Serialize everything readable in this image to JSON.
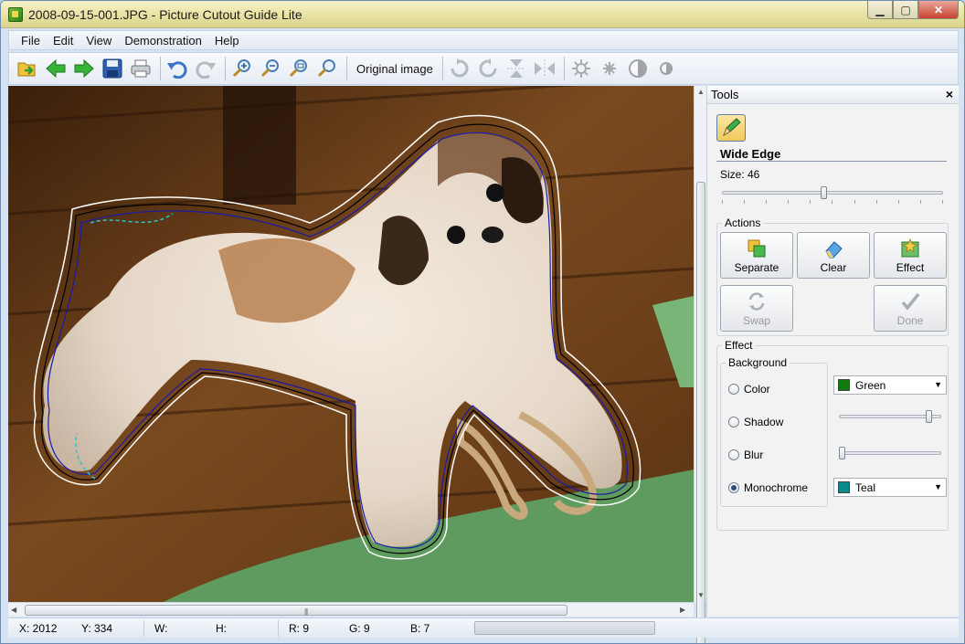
{
  "window": {
    "title": "2008-09-15-001.JPG - Picture Cutout Guide Lite"
  },
  "menu": [
    "File",
    "Edit",
    "View",
    "Demonstration",
    "Help"
  ],
  "toolbar": {
    "view_label": "Original image",
    "icons": [
      "open-icon",
      "back-icon",
      "forward-icon",
      "save-icon",
      "print-icon",
      "undo-icon",
      "redo-icon",
      "zoom-in-icon",
      "zoom-out-icon",
      "zoom-fit-icon",
      "zoom-actual-icon",
      "rotate-right-icon",
      "rotate-left-icon",
      "flip-vertical-icon",
      "flip-horizontal-icon",
      "brightness-icon",
      "settings-icon",
      "contrast-icon",
      "saturation-icon"
    ]
  },
  "colors": {
    "edge_outer": "#ffffff",
    "edge_mid": "#000000",
    "edge_inner": "#1a1aa8",
    "edge_accent": "#2fc4c4",
    "green": "#117a11",
    "teal": "#0a8a8a"
  },
  "tools": {
    "title": "Tools",
    "tool_name": "Wide Edge",
    "size_label": "Size: 46",
    "size_value": 46,
    "actions_title": "Actions",
    "buttons": {
      "separate": "Separate",
      "clear": "Clear",
      "effect": "Effect",
      "swap": "Swap",
      "done": "Done"
    },
    "effect_title": "Effect",
    "background_title": "Background",
    "options": [
      "Color",
      "Shadow",
      "Blur",
      "Monochrome"
    ],
    "selected_option": "Monochrome",
    "color_combo": "Green",
    "mono_combo": "Teal",
    "shadow_level": 0.9,
    "blur_level": 0.0
  },
  "status": {
    "x": "X: 2012",
    "y": "Y: 334",
    "w": "W:",
    "h": "H:",
    "r": "R: 9",
    "g": "G: 9",
    "b": "B: 7"
  }
}
